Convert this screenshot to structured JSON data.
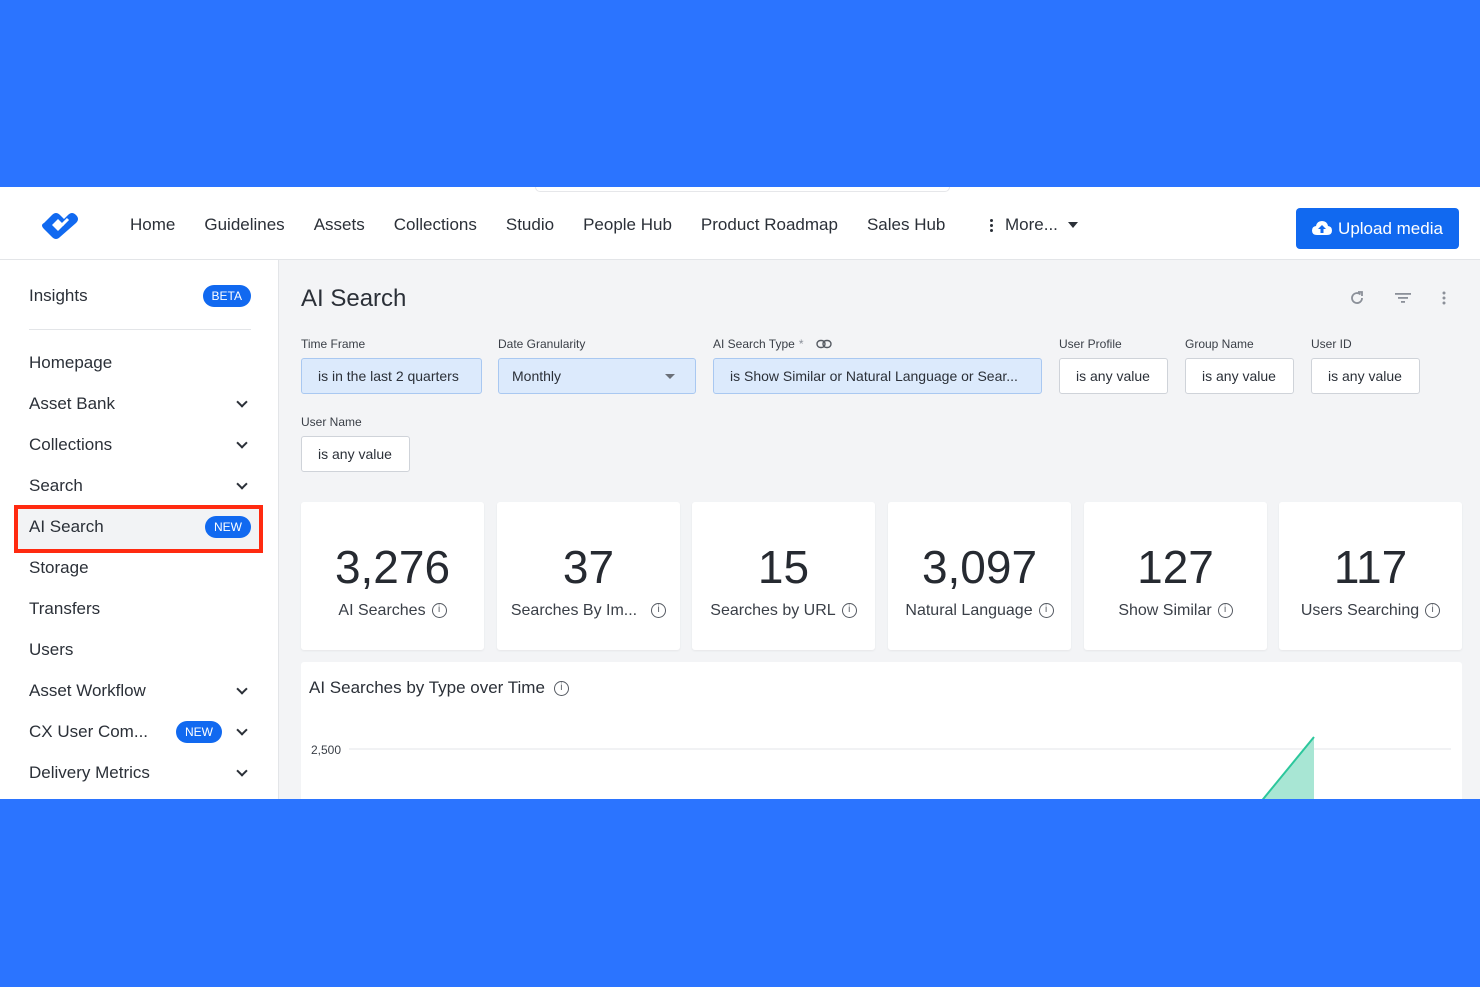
{
  "topnav": {
    "links": [
      "Home",
      "Guidelines",
      "Assets",
      "Collections",
      "Studio",
      "People Hub",
      "Product Roadmap",
      "Sales Hub"
    ],
    "more_label": "More...",
    "upload_label": "Upload media"
  },
  "sidebar": {
    "insights": {
      "label": "Insights",
      "badge": "BETA"
    },
    "items": [
      {
        "label": "Homepage",
        "chevron": false
      },
      {
        "label": "Asset Bank",
        "chevron": true
      },
      {
        "label": "Collections",
        "chevron": true
      },
      {
        "label": "Search",
        "chevron": true
      },
      {
        "label": "AI Search",
        "badge": "NEW",
        "chevron": false,
        "selected": true
      },
      {
        "label": "Storage",
        "chevron": false
      },
      {
        "label": "Transfers",
        "chevron": false
      },
      {
        "label": "Users",
        "chevron": false
      },
      {
        "label": "Asset Workflow",
        "chevron": true
      },
      {
        "label": "CX User Com...",
        "badge": "NEW",
        "chevron": true
      },
      {
        "label": "Delivery Metrics",
        "chevron": true
      }
    ]
  },
  "main": {
    "title": "AI Search",
    "filters": {
      "time_frame": {
        "label": "Time Frame",
        "value": "is in the last 2 quarters"
      },
      "date_granularity": {
        "label": "Date Granularity",
        "value": "Monthly"
      },
      "ai_search_type": {
        "label": "AI Search Type",
        "required": "*",
        "value": "is Show Similar or Natural Language or Sear..."
      },
      "user_profile": {
        "label": "User Profile",
        "value": "is any value"
      },
      "group_name": {
        "label": "Group Name",
        "value": "is any value"
      },
      "user_id": {
        "label": "User ID",
        "value": "is any value"
      },
      "user_name": {
        "label": "User Name",
        "value": "is any value"
      }
    },
    "kpis": [
      {
        "value": "3,276",
        "label": "AI Searches"
      },
      {
        "value": "37",
        "label": "Searches By Im..."
      },
      {
        "value": "15",
        "label": "Searches by URL"
      },
      {
        "value": "3,097",
        "label": "Natural Language"
      },
      {
        "value": "127",
        "label": "Show Similar"
      },
      {
        "value": "117",
        "label": "Users Searching"
      }
    ],
    "chart": {
      "title": "AI Searches by Type over Time"
    }
  },
  "chart_data": {
    "type": "area",
    "title": "AI Searches by Type over Time",
    "y_tick_labels": [
      "2,500"
    ],
    "series": [
      {
        "values_visible_fragment": [
          1500,
          2700
        ]
      }
    ],
    "colors": {
      "area": "#a8e6d4",
      "line": "#2cc79c"
    }
  },
  "colors": {
    "accent": "#1169f0",
    "highlight_border": "#ff2a10",
    "background": "#2b74ff"
  }
}
